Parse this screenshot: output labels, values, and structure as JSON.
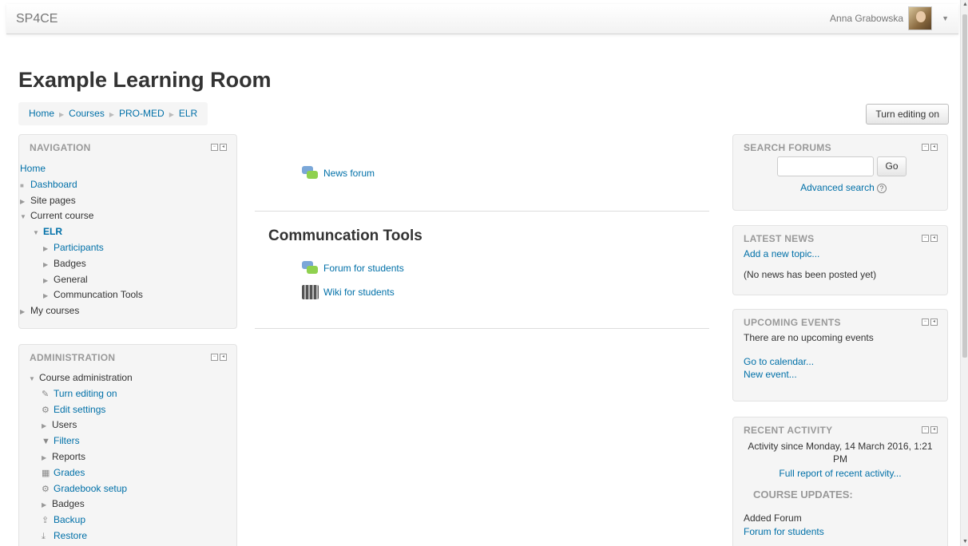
{
  "navbar": {
    "brand": "SP4CE",
    "user_name": "Anna Grabowska"
  },
  "page_title": "Example Learning Room",
  "breadcrumb": [
    "Home",
    "Courses",
    "PRO-MED",
    "ELR"
  ],
  "turn_editing_button": "Turn editing on",
  "navigation": {
    "title": "NAVIGATION",
    "home": "Home",
    "dashboard": "Dashboard",
    "site_pages": "Site pages",
    "current_course": "Current course",
    "course": "ELR",
    "participants": "Participants",
    "badges": "Badges",
    "general": "General",
    "communcation_tools": "Communcation Tools",
    "my_courses": "My courses"
  },
  "administration": {
    "title": "ADMINISTRATION",
    "course_administration": "Course administration",
    "turn_editing_on": "Turn editing on",
    "edit_settings": "Edit settings",
    "users": "Users",
    "filters": "Filters",
    "reports": "Reports",
    "grades": "Grades",
    "gradebook_setup": "Gradebook setup",
    "badges": "Badges",
    "backup": "Backup",
    "restore": "Restore"
  },
  "main": {
    "news_forum": "News forum",
    "section_title": "Communcation Tools",
    "forum_for_students": "Forum for students",
    "wiki_for_students": "Wiki for students"
  },
  "search_forums": {
    "title": "SEARCH FORUMS",
    "go": "Go",
    "advanced": "Advanced search",
    "help": "?"
  },
  "latest_news": {
    "title": "LATEST NEWS",
    "add": "Add a new topic...",
    "none": "(No news has been posted yet)"
  },
  "upcoming_events": {
    "title": "UPCOMING EVENTS",
    "none": "There are no upcoming events",
    "calendar": "Go to calendar...",
    "new_event": "New event..."
  },
  "recent_activity": {
    "title": "RECENT ACTIVITY",
    "since": "Activity since Monday, 14 March 2016, 1:21 PM",
    "full_report": "Full report of recent activity...",
    "course_updates": "COURSE UPDATES:",
    "added_forum": "Added Forum",
    "forum_link": "Forum for students"
  }
}
